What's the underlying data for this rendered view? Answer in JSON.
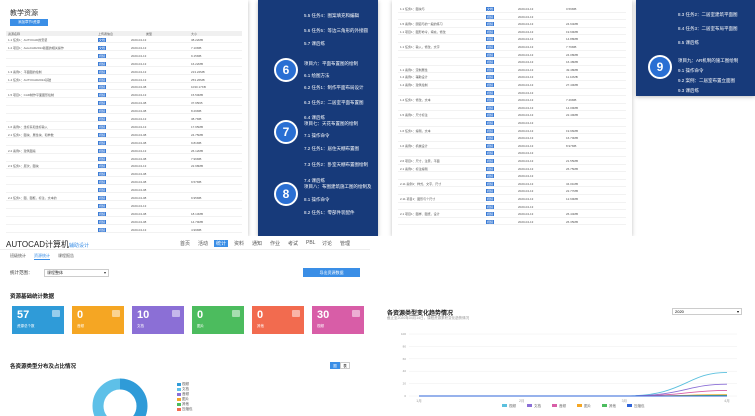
{
  "p1": {
    "title": "教学资源",
    "button": "添加章节/资源",
    "header": [
      "资源名称",
      "上传者信息",
      "类型",
      "大小"
    ],
    "rows": [
      [
        "1.1 任务1：AUTOCAD的安装",
        "文档",
        "2020-04-13",
        "38.22MB"
      ],
      [
        "1.2 项目1：AutoCAD2014版图的相关操作",
        "文档",
        "2020-04-13",
        "7.10MB"
      ],
      [
        "",
        "视频",
        "2020-04-13",
        "9.15MB"
      ],
      [
        "",
        "视频",
        "2020-04-13",
        "16.22MB"
      ],
      [
        "1.3 案例1：平面图的绘制",
        "视频",
        "2020-04-13",
        "213.22MB"
      ],
      [
        "1.4 任务1：AUTOCAD2014基础",
        "视频",
        "2020-04-13",
        "253.26MB"
      ],
      [
        "",
        "视频",
        "2020-04-08",
        "1030.17KB"
      ],
      [
        "1.5 项目1：CAD制作平面图形绘制",
        "视频",
        "2020-04-13",
        "15.50MB"
      ],
      [
        "",
        "视频",
        "2020-04-08",
        "37.95KB"
      ],
      [
        "",
        "视频",
        "2020-04-08",
        "8.29MB"
      ],
      [
        "",
        "视频",
        "2020-04-13",
        "38.7MB"
      ],
      [
        "1.6 案例1：坐标系和坐标输入",
        "视频",
        "2020-04-13",
        "17.95MB"
      ],
      [
        "2.1 任务1：图块、属性块、和参数",
        "视频",
        "2020-04-08",
        "24.75MB"
      ],
      [
        "",
        "视频",
        "2020-04-08",
        "9.81MB"
      ],
      [
        "2.2 案例1：建筑图案",
        "视频",
        "2020-04-13",
        "26.12MB"
      ],
      [
        "",
        "视频",
        "2020-04-08",
        "7.96MB"
      ],
      [
        "2.3 任务1：层次，图块",
        "视频",
        "2020-04-13",
        "22.98MB"
      ],
      [
        "",
        "视频",
        "2020-04-08",
        ""
      ],
      [
        "",
        "视频",
        "2020-04-08",
        "9.57MB"
      ],
      [
        "",
        "视频",
        "2020-04-08",
        ""
      ],
      [
        "2.4 任务1：图、图框，标注，文本的",
        "视频",
        "2020-04-08",
        "9.95MB"
      ],
      [
        "",
        "视频",
        "2020-04-13",
        ""
      ],
      [
        "",
        "视频",
        "2020-04-08",
        "18.13MB"
      ],
      [
        "",
        "视频",
        "2020-04-08",
        "14.79MB"
      ],
      [
        "",
        "视频",
        "2020-04-13",
        "4.99MB"
      ]
    ]
  },
  "p2": {
    "top_items": [
      "5.5  任务4：图案填充和编辑",
      "5.6  任务5：等边三角形的外接圆",
      "5.7  课后练"
    ],
    "groups": [
      {
        "num": "6",
        "title": "项目六：平面布置图的绘制",
        "items": [
          "6.1  绘图方法",
          "6.2  任务1：制作平面布局设计",
          "6.3  任务2：二居室平面布置图",
          "6.4  课后练"
        ]
      },
      {
        "num": "7",
        "title": "项目七：天花布置图的绘制",
        "items": [
          "7.1  操作命令",
          "7.2  任务1：居住天棚布置图",
          "7.3  任务2：卧室天棚布置图绘制",
          "7.4  课后练"
        ]
      },
      {
        "num": "8",
        "title": "项目八：布图建筑施工图的绘制及",
        "items": [
          "8.1  操作命令",
          "8.2  任务1：零部件装配件"
        ]
      }
    ]
  },
  "p3": {
    "rows": [
      [
        "1.1 任务1：图块与",
        "文档",
        "2020-04-13",
        "0.59MB"
      ],
      [
        "",
        "视频",
        "2020-04-13",
        ""
      ],
      [
        "1.5 案例1：圆弧与的一般的练习",
        "视频",
        "2020-04-13",
        "24.64MB"
      ],
      [
        "1.1 项目1：图形命令，填充，修改",
        "视频",
        "2020-04-13",
        "19.69MB"
      ],
      [
        "",
        "视频",
        "2020-04-13",
        "14.88MB"
      ],
      [
        "1.1 任务1：输入，修改，文字",
        "视频",
        "2020-04-13",
        "7.79MB"
      ],
      [
        "",
        "视频",
        "2020-04-13",
        "24.08MB"
      ],
      [
        "",
        "视频",
        "2020-04-13",
        "16.48MB"
      ],
      [
        "1.1 案例1：定制属性",
        "视频",
        "2020-04-13",
        "49.48MB"
      ],
      [
        "1.4 案例1：辅助设计",
        "视频",
        "2020-04-13",
        "11.10MB"
      ],
      [
        "1.4 案例1：建筑绘制",
        "视频",
        "2020-04-13",
        "27.40MB"
      ],
      [
        "",
        "视频",
        "2020-04-13",
        ""
      ],
      [
        "1.4 任务1：修改，文本",
        "视频",
        "2020-04-13",
        "7.49MB"
      ],
      [
        "",
        "视频",
        "2020-04-13",
        "14.09MB"
      ],
      [
        "1.5 案例1：尺寸标注",
        "视频",
        "2020-04-13",
        "22.49MB"
      ],
      [
        "",
        "视频",
        "2020-04-13",
        ""
      ],
      [
        "1.6 任务1：编辑，文本",
        "视频",
        "2020-04-13",
        "19.96MB"
      ],
      [
        "",
        "视频",
        "2020-04-13",
        "16.70MB"
      ],
      [
        "1.6 案例1：机械设计",
        "视频",
        "2020-04-13",
        "8.97MB"
      ],
      [
        "",
        "视频",
        "2020-04-13",
        ""
      ],
      [
        "2.6 项目1：尺寸，注意，平面",
        "视频",
        "2020-04-13",
        "21.55MB"
      ],
      [
        "2.1 案例1：标注编辑",
        "视频",
        "2020-04-13",
        "26.75MB"
      ],
      [
        "",
        "视频",
        "2020-04-13",
        ""
      ],
      [
        "2.11 案例1：样式，文字，尺寸",
        "视频",
        "2020-04-13",
        "34.01MB"
      ],
      [
        "",
        "视频",
        "2020-04-13",
        "22.77MB"
      ],
      [
        "2.11 项目1：图形与个尺寸",
        "视频",
        "2020-04-13",
        "12.69MB"
      ],
      [
        "",
        "视频",
        "2020-04-13",
        ""
      ],
      [
        "2.1 项目1：图样、图纸，设计",
        "视频",
        "2020-04-13",
        "26.44MB"
      ],
      [
        "",
        "视频",
        "2020-04-13",
        "26.35MB"
      ]
    ]
  },
  "p4": {
    "top_items": [
      "8.3  任务2：二居室建筑平面图",
      "8.4  任务3：二居室布局平面图",
      "8.5  课后练"
    ],
    "group": {
      "num": "9",
      "title": "项目九：AR机制的施工图绘制",
      "items": [
        "9.1  操作命令",
        "9.2  案例：二居室布置立面图",
        "9.3  课后练"
      ]
    }
  },
  "app": {
    "logo": "AUTOCAD计算机",
    "logo_sub": "辅助设计",
    "nav": [
      "首页",
      "活动",
      "统计",
      "资料",
      "通知",
      "作业",
      "考试",
      "PBL",
      "讨论",
      "管理"
    ],
    "nav_active": 2,
    "subtabs": [
      "班级统计",
      "资源统计",
      "课程报告"
    ],
    "sub_active": 1,
    "stat_label": "统计范围：",
    "stat_value": "课程整体",
    "export": "导出资源数据",
    "section1": "资源基础统计数据",
    "cards": [
      {
        "value": "57",
        "label": "资源总个数",
        "color": "#2f9bd8"
      },
      {
        "value": "0",
        "label": "音频",
        "color": "#f5a623"
      },
      {
        "value": "10",
        "label": "文档",
        "color": "#8b6fd6"
      },
      {
        "value": "0",
        "label": "图片",
        "color": "#4cbc5e"
      },
      {
        "value": "0",
        "label": "其他",
        "color": "#f26b4f"
      },
      {
        "value": "30",
        "label": "视频",
        "color": "#d85da7"
      }
    ],
    "section2": "各资源类型分布及占比情况",
    "toggle": [
      "图",
      "表"
    ],
    "legend": [
      "视频",
      "文档",
      "音频",
      "图片",
      "其他",
      "压缩包"
    ],
    "legend_colors": [
      "#2f9bd8",
      "#5ec0e8",
      "#8b6fd6",
      "#f5a623",
      "#4cbc5e",
      "#f26b4f"
    ]
  },
  "chart": {
    "title": "各资源类型变化趋势情况",
    "subtitle": "截止至2020年04月14日，课程资源累积变化趋势情况",
    "year": "2020",
    "chart_data": {
      "type": "line",
      "categories": [
        "1月",
        "2月",
        "3月",
        "4月"
      ],
      "ylim": [
        0,
        100
      ],
      "yticks": [
        0,
        20,
        40,
        60,
        80,
        100
      ],
      "series": [
        {
          "name": "视频",
          "color": "#5bc0de",
          "values": [
            0,
            0,
            0,
            38
          ]
        },
        {
          "name": "文档",
          "color": "#8b6fd6",
          "values": [
            0,
            0,
            0,
            19
          ]
        },
        {
          "name": "音频",
          "color": "#d85da7",
          "values": [
            0,
            0,
            0,
            9
          ]
        },
        {
          "name": "图片",
          "color": "#f5a623",
          "values": [
            0,
            0,
            0,
            2
          ]
        },
        {
          "name": "其他",
          "color": "#4cbc5e",
          "values": [
            0,
            0,
            0,
            1
          ]
        },
        {
          "name": "压缩包",
          "color": "#2f64d8",
          "values": [
            0,
            0,
            0,
            0
          ]
        }
      ]
    }
  }
}
